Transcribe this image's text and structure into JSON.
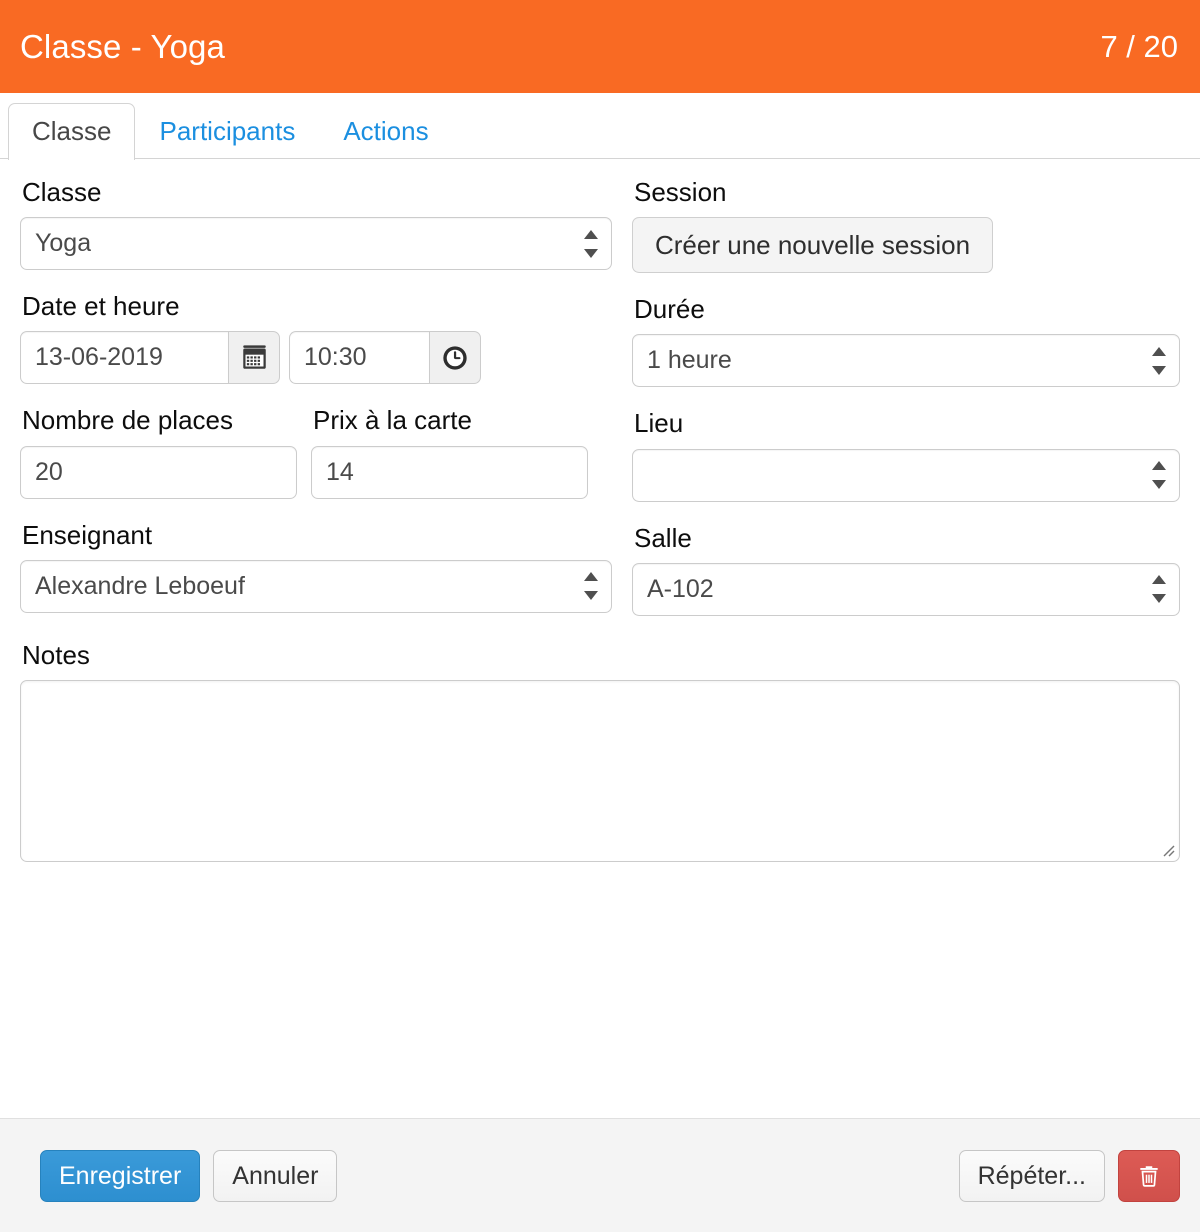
{
  "header": {
    "title": "Classe - Yoga",
    "counter": "7 / 20",
    "accent_color": "#f96a23"
  },
  "tabs": [
    {
      "label": "Classe",
      "active": true
    },
    {
      "label": "Participants",
      "active": false
    },
    {
      "label": "Actions",
      "active": false
    }
  ],
  "form": {
    "classe": {
      "label": "Classe",
      "value": "Yoga"
    },
    "session": {
      "label": "Session",
      "button_label": "Créer une nouvelle session"
    },
    "date_heure": {
      "label": "Date et heure",
      "date_value": "13-06-2019",
      "time_value": "10:30",
      "calendar_icon": "calendar-icon",
      "clock_icon": "clock-icon"
    },
    "duree": {
      "label": "Durée",
      "value": "1 heure"
    },
    "nombre_de_places": {
      "label": "Nombre de places",
      "value": "20"
    },
    "prix_a_la_carte": {
      "label": "Prix à la carte",
      "value": "14"
    },
    "lieu": {
      "label": "Lieu",
      "value": ""
    },
    "enseignant": {
      "label": "Enseignant",
      "value": "Alexandre Leboeuf"
    },
    "salle": {
      "label": "Salle",
      "value": "A-102"
    },
    "notes": {
      "label": "Notes",
      "value": ""
    }
  },
  "footer": {
    "save_label": "Enregistrer",
    "cancel_label": "Annuler",
    "repeat_label": "Répéter...",
    "delete_icon": "trash-icon",
    "primary_color": "#2d8fd0",
    "danger_color": "#d0504b"
  }
}
